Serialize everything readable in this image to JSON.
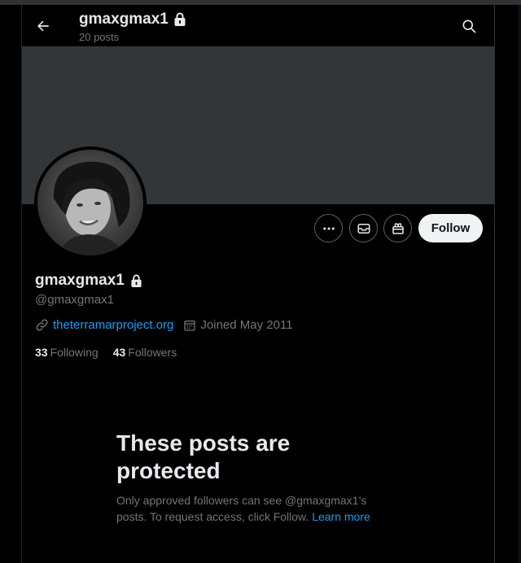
{
  "header": {
    "title": "gmaxgmax1",
    "subtitle": "20 posts"
  },
  "profile": {
    "display_name": "gmaxgmax1",
    "handle": "@gmaxgmax1",
    "website": "theterramarproject.org",
    "joined": "Joined May 2011",
    "following_count": "33",
    "following_label": "Following",
    "followers_count": "43",
    "followers_label": "Followers"
  },
  "actions": {
    "follow_label": "Follow"
  },
  "protected": {
    "title": "These posts are protected",
    "body": "Only approved followers can see @gmaxgmax1’s posts. To request access, click Follow.",
    "learn_more": "Learn more"
  },
  "colors": {
    "background": "#000000",
    "banner": "#333639",
    "accent": "#1d9bf0",
    "text_primary": "#e7e9ea",
    "text_secondary": "#71767b"
  },
  "icons": [
    "back-arrow-icon",
    "lock-icon",
    "search-icon",
    "more-icon",
    "mail-icon",
    "gift-icon",
    "link-icon",
    "calendar-icon"
  ]
}
